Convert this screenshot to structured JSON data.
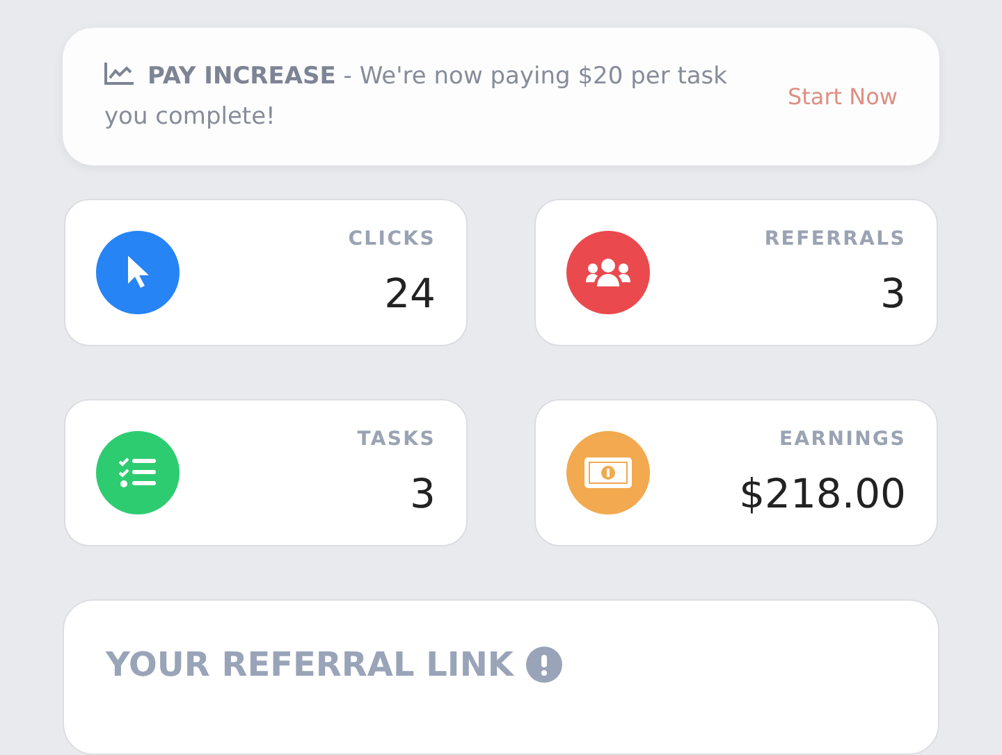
{
  "banner": {
    "message": "**PAY INCREASE**  -  We're now paying $20 per task you complete!",
    "action": "Start Now"
  },
  "stats": [
    {
      "label": "CLICKS",
      "value": "24",
      "kind": "cursor",
      "color": "#2684f4"
    },
    {
      "label": "REFERRALS",
      "value": "3",
      "kind": "users",
      "color": "#ea4a4d"
    },
    {
      "label": "TASKS",
      "value": "3",
      "kind": "tasks",
      "color": "#2ecc71"
    },
    {
      "label": "EARNINGS",
      "value": "$218.00",
      "kind": "money",
      "color": "#f2a94f"
    }
  ],
  "referral": {
    "title": "YOUR REFERRAL LINK"
  }
}
